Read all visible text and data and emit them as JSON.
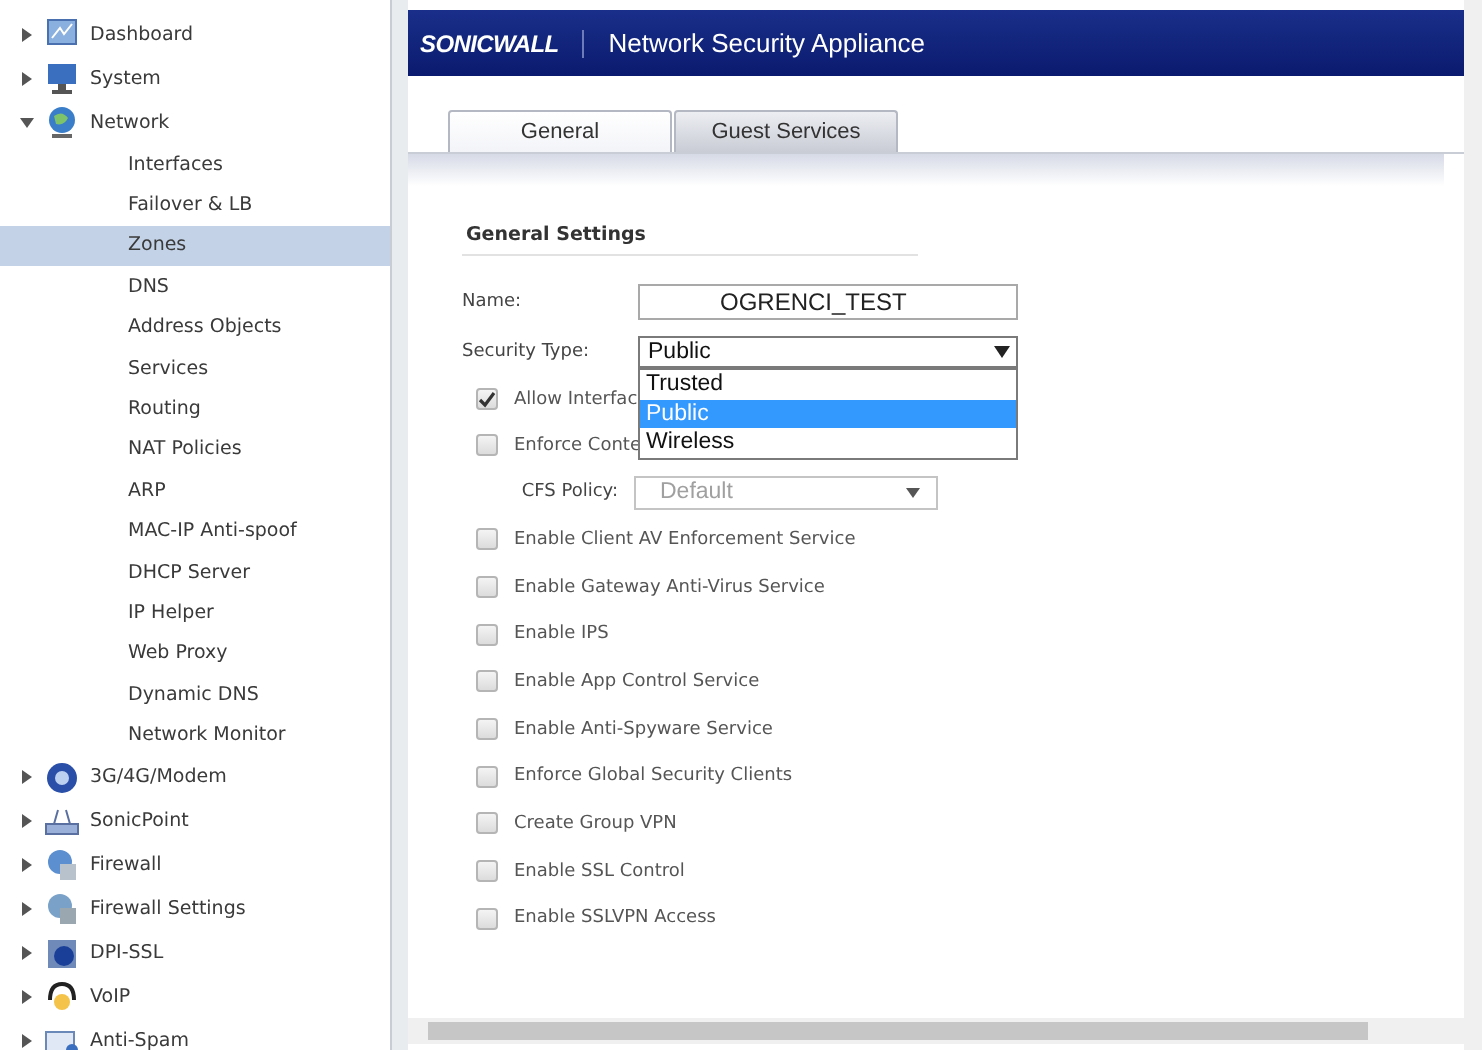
{
  "sidebar": {
    "items": [
      {
        "label": "Dashboard",
        "expanded": false
      },
      {
        "label": "System",
        "expanded": false
      },
      {
        "label": "Network",
        "expanded": true,
        "children": [
          {
            "label": "Interfaces",
            "selected": false
          },
          {
            "label": "Failover & LB",
            "selected": false
          },
          {
            "label": "Zones",
            "selected": true
          },
          {
            "label": "DNS",
            "selected": false
          },
          {
            "label": "Address Objects",
            "selected": false
          },
          {
            "label": "Services",
            "selected": false
          },
          {
            "label": "Routing",
            "selected": false
          },
          {
            "label": "NAT Policies",
            "selected": false
          },
          {
            "label": "ARP",
            "selected": false
          },
          {
            "label": "MAC-IP Anti-spoof",
            "selected": false
          },
          {
            "label": "DHCP Server",
            "selected": false
          },
          {
            "label": "IP Helper",
            "selected": false
          },
          {
            "label": "Web Proxy",
            "selected": false
          },
          {
            "label": "Dynamic DNS",
            "selected": false
          },
          {
            "label": "Network Monitor",
            "selected": false
          }
        ]
      },
      {
        "label": "3G/4G/Modem",
        "expanded": false
      },
      {
        "label": "SonicPoint",
        "expanded": false
      },
      {
        "label": "Firewall",
        "expanded": false
      },
      {
        "label": "Firewall Settings",
        "expanded": false
      },
      {
        "label": "DPI-SSL",
        "expanded": false
      },
      {
        "label": "VoIP",
        "expanded": false
      },
      {
        "label": "Anti-Spam",
        "expanded": false
      }
    ]
  },
  "header": {
    "logo": "SONICWALL",
    "title": "Network Security Appliance"
  },
  "tabs": [
    {
      "label": "General",
      "selected": true
    },
    {
      "label": "Guest Services",
      "selected": false
    }
  ],
  "section_title": "General Settings",
  "name_field": {
    "label": "Name:",
    "value": "OGRENCI_TEST"
  },
  "security_type": {
    "label": "Security Type:",
    "value": "Public",
    "open": true,
    "options": [
      {
        "label": "Trusted",
        "selected": false
      },
      {
        "label": "Public",
        "selected": true
      },
      {
        "label": "Wireless",
        "selected": false
      }
    ]
  },
  "options_top": [
    {
      "label": "Allow Interfac",
      "checked": true
    },
    {
      "label": "Enforce Conte",
      "checked": false
    }
  ],
  "cfs_policy": {
    "label": "CFS Policy:",
    "value": "Default",
    "disabled": true
  },
  "options": [
    {
      "label": "Enable Client AV Enforcement Service",
      "checked": false
    },
    {
      "label": "Enable Gateway Anti-Virus Service",
      "checked": false
    },
    {
      "label": "Enable IPS",
      "checked": false
    },
    {
      "label": "Enable App Control Service",
      "checked": false
    },
    {
      "label": "Enable Anti-Spyware Service",
      "checked": false
    },
    {
      "label": "Enforce Global Security Clients",
      "checked": false
    },
    {
      "label": "Create Group VPN",
      "checked": false
    },
    {
      "label": "Enable SSL Control",
      "checked": false
    },
    {
      "label": "Enable SSLVPN Access",
      "checked": false
    }
  ]
}
